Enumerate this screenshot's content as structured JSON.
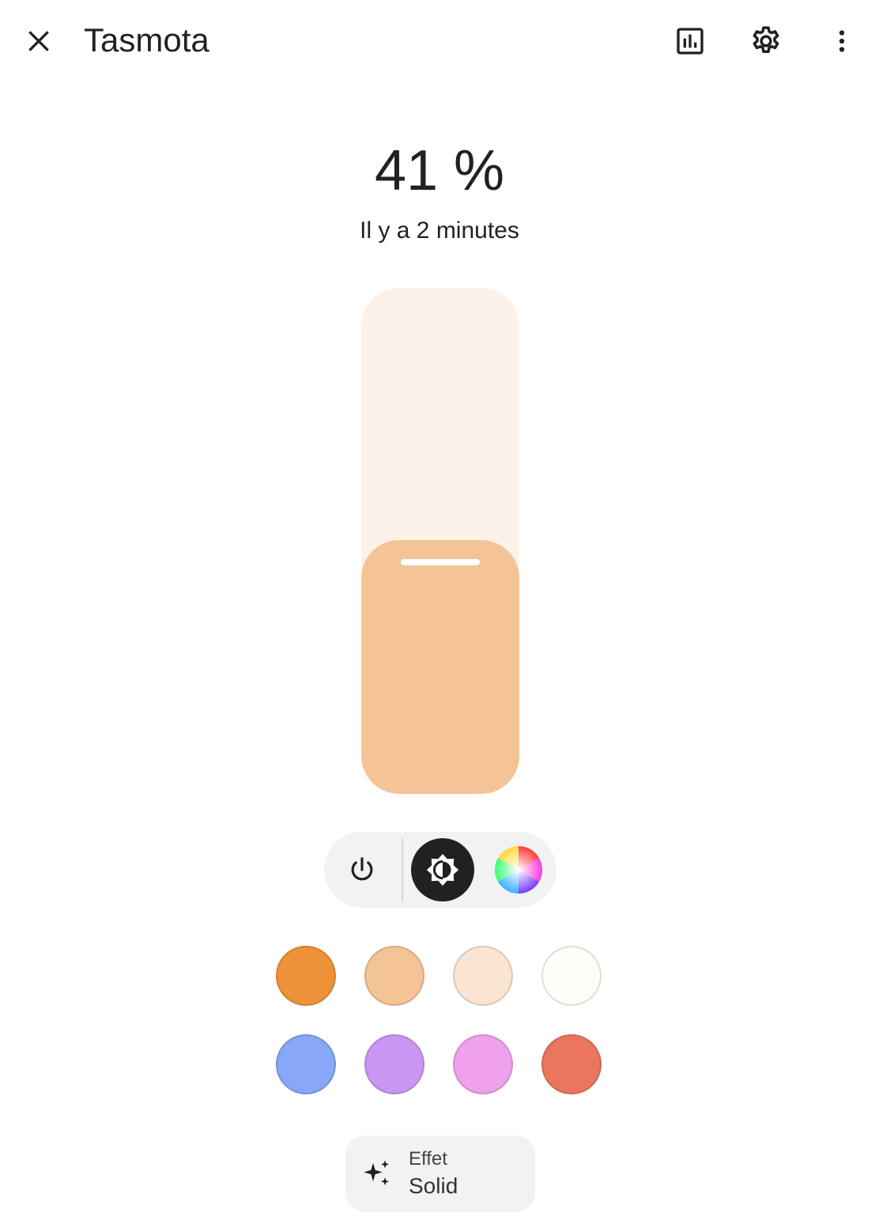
{
  "header": {
    "title": "Tasmota",
    "icons": {
      "close": "close-icon",
      "history": "chart-icon",
      "settings": "gear-icon",
      "menu": "more-vert-icon"
    }
  },
  "state": {
    "value": "41 %",
    "brightness_percent": 41,
    "last_changed": "Il y a 2 minutes"
  },
  "colors": {
    "light": "#f4c396",
    "track": "#fcf2e9",
    "mode_active_bg": "#212121"
  },
  "modes": {
    "items": [
      {
        "icon": "power-icon",
        "active": false
      },
      {
        "icon": "brightness-icon",
        "active": true
      },
      {
        "icon": "color-wheel-icon",
        "active": false
      }
    ]
  },
  "favorite_colors": [
    "#ee9239",
    "#f4c396",
    "#fbe4d2",
    "#fffdf8",
    "#87a8f6",
    "#c996f3",
    "#efa1e9",
    "#eb765e"
  ],
  "effect": {
    "label": "Effet",
    "value": "Solid",
    "icon": "sparkles-icon"
  }
}
